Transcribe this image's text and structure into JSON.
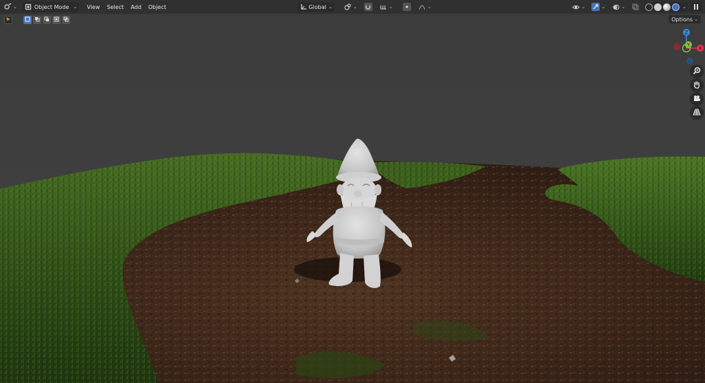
{
  "header": {
    "mode_label": "Object Mode",
    "menus": [
      "View",
      "Select",
      "Add",
      "Object"
    ],
    "transform_orientation": "Global"
  },
  "options_label": "Options",
  "gizmo": {
    "axis_z": "Z",
    "axis_x": "X",
    "axis_y": "Y",
    "colors": {
      "x": "#e5334f",
      "y": "#87c33b",
      "z": "#3b8de5"
    }
  },
  "colors": {
    "header_bg": "#303030",
    "viewport_bg": "#3d3d3d",
    "accent_blue": "#4772b3"
  }
}
